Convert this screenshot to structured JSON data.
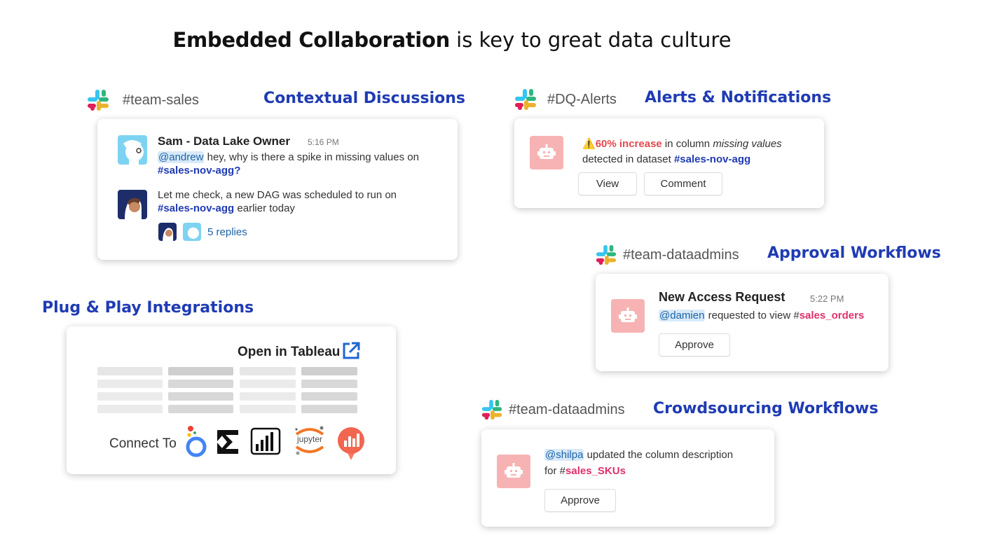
{
  "title": {
    "bold": "Embedded Collaboration",
    "rest": "is key to great data culture"
  },
  "colors": {
    "accent_blue": "#1f3bb3",
    "tag_pink": "#e0306c",
    "alert_red": "#e5484d",
    "bot_pink": "#f7b3b3",
    "mention_bg": "#d8eaf8"
  },
  "contextual": {
    "channel": "#team-sales",
    "label": "Contextual Discussions",
    "msg1": {
      "author": "Sam - Data Lake Owner",
      "time": "5:16 PM",
      "mention": "@andrew",
      "text": " hey, why is there a spike in missing values on",
      "tag": "#sales-nov-agg",
      "suffix": "?"
    },
    "msg2": {
      "line1": "Let me check, a new DAG was scheduled to run on",
      "tag": "#sales-nov-agg",
      "rest": " earlier today"
    },
    "replies": "5 replies"
  },
  "alerts": {
    "channel": "#DQ-Alerts",
    "label": "Alerts & Notifications",
    "warn": "⚠️",
    "increase": "60% increase",
    "text1": " in column ",
    "column": "missing values",
    "text2": "detected in dataset ",
    "tag": "#sales-nov-agg",
    "view": "View",
    "comment": "Comment"
  },
  "approval": {
    "channel": "#team-dataadmins",
    "label": "Approval Workflows",
    "heading": "New Access Request",
    "time": "5:22 PM",
    "mention": "@damien",
    "text": " requested to view #",
    "tag": "sales_orders",
    "button": "Approve"
  },
  "integrations": {
    "label": "Plug & Play Integrations",
    "open": "Open in Tableau",
    "connect": "Connect To",
    "tools": [
      "looker-icon",
      "sigma-icon",
      "powerbi-icon",
      "jupyter-icon",
      "redash-icon"
    ],
    "jupyter_text": "jupyter"
  },
  "crowdsourcing": {
    "channel": "#team-dataadmins",
    "label": "Crowdsourcing Workflows",
    "mention": "@shilpa",
    "text1": " updated the column description",
    "text2": "for #",
    "tag": "sales_SKUs",
    "button": "Approve"
  }
}
